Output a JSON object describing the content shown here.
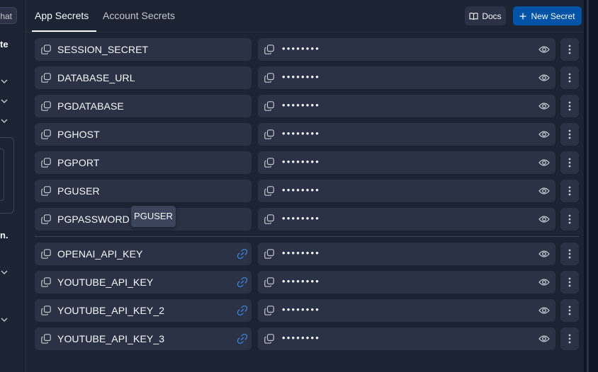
{
  "left_sidebar": {
    "chat_button": "hat",
    "fragment_1": "te",
    "fragment_2": "n."
  },
  "tabs": [
    {
      "label": "App Secrets",
      "active": true
    },
    {
      "label": "Account Secrets",
      "active": false
    }
  ],
  "toolbar": {
    "docs_label": "Docs",
    "docs_icon": "book-icon",
    "new_secret_label": "New Secret",
    "new_secret_icon": "plus-icon"
  },
  "secrets_app": [
    {
      "key": "SESSION_SECRET",
      "value": "••••••••"
    },
    {
      "key": "DATABASE_URL",
      "value": "••••••••"
    },
    {
      "key": "PGDATABASE",
      "value": "••••••••"
    },
    {
      "key": "PGHOST",
      "value": "••••••••"
    },
    {
      "key": "PGPORT",
      "value": "••••••••"
    },
    {
      "key": "PGUSER",
      "value": "••••••••"
    },
    {
      "key": "PGPASSWORD",
      "value": "••••••••"
    }
  ],
  "secrets_linked": [
    {
      "key": "OPENAI_API_KEY",
      "value": "••••••••",
      "linked": true
    },
    {
      "key": "YOUTUBE_API_KEY",
      "value": "••••••••",
      "linked": true
    },
    {
      "key": "YOUTUBE_API_KEY_2",
      "value": "••••••••",
      "linked": true
    },
    {
      "key": "YOUTUBE_API_KEY_3",
      "value": "••••••••",
      "linked": true
    }
  ],
  "tooltip": "PGUSER",
  "colors": {
    "background": "#0e1525",
    "panel": "#1c2333",
    "field": "#2b3245",
    "accent": "#0053a6",
    "link": "#3b82d6"
  }
}
